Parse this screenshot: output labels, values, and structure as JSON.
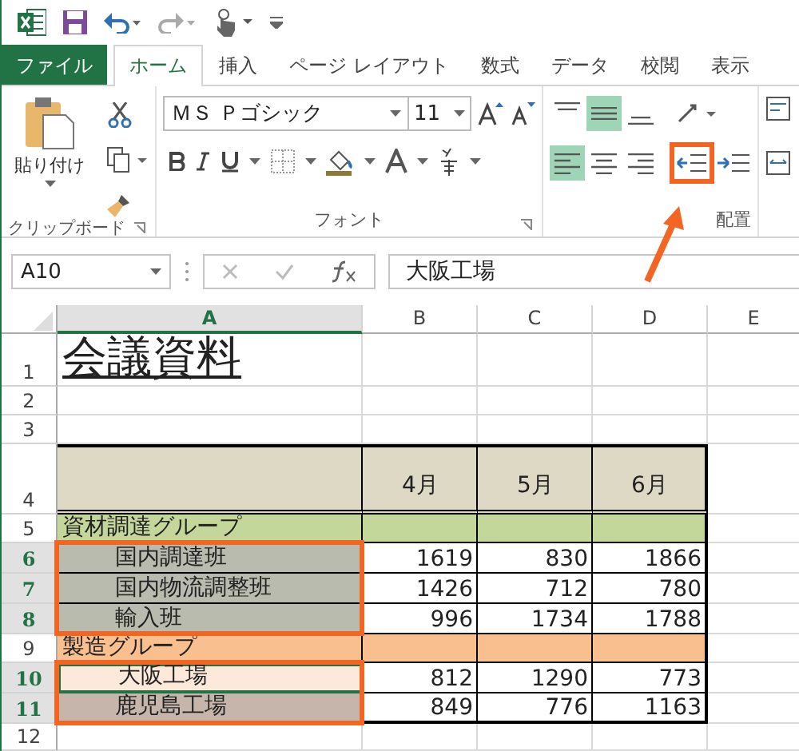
{
  "tabs": [
    {
      "label": "ファイル",
      "kind": "file",
      "selected": false
    },
    {
      "label": "ホーム",
      "kind": "tab",
      "selected": true
    },
    {
      "label": "挿入",
      "kind": "tab",
      "selected": false
    },
    {
      "label": "ページ レイアウト",
      "kind": "tab",
      "selected": false
    },
    {
      "label": "数式",
      "kind": "tab",
      "selected": false
    },
    {
      "label": "データ",
      "kind": "tab",
      "selected": false
    },
    {
      "label": "校閲",
      "kind": "tab",
      "selected": false
    },
    {
      "label": "表示",
      "kind": "tab",
      "selected": false
    }
  ],
  "ribbon": {
    "paste_label": "貼り付け",
    "font_name": "ＭＳ Ｐゴシック",
    "font_size": "11",
    "groups": [
      "クリップボード",
      "フォント",
      "配置"
    ],
    "vertical_align": [
      {
        "kind": "top",
        "selected": false
      },
      {
        "kind": "middle",
        "selected": true
      },
      {
        "kind": "bottom",
        "selected": false
      }
    ],
    "horizontal_align": [
      {
        "kind": "left",
        "selected": true
      },
      {
        "kind": "center",
        "selected": false
      },
      {
        "kind": "right",
        "selected": false
      }
    ],
    "outdent_outlined": true
  },
  "formula_bar": {
    "name_box": "A10",
    "value": "大阪工場"
  },
  "sheet": {
    "columns": [
      {
        "label": "A",
        "selected": true
      },
      {
        "label": "B",
        "selected": false
      },
      {
        "label": "C",
        "selected": false
      },
      {
        "label": "D",
        "selected": false
      },
      {
        "label": "E",
        "selected": false
      }
    ],
    "rows": [
      {
        "number": "1",
        "kind": "title",
        "selected": false,
        "cells": [
          "会議資料"
        ]
      },
      {
        "number": "2",
        "kind": "blank",
        "selected": false,
        "cells": []
      },
      {
        "number": "3",
        "kind": "blank",
        "selected": false,
        "cells": []
      },
      {
        "number": "4",
        "kind": "header",
        "selected": false,
        "color": "#ddd9c4",
        "cells": [
          "",
          "4月",
          "5月",
          "6月"
        ]
      },
      {
        "number": "5",
        "kind": "group",
        "selected": false,
        "color": "#c4d79b",
        "cells": [
          "資材調達グループ"
        ]
      },
      {
        "number": "6",
        "kind": "item",
        "selected": true,
        "outlined": true,
        "active": false,
        "color": "#b8bbad",
        "cells": [
          "国内調達班",
          "1619",
          "830",
          "1866"
        ]
      },
      {
        "number": "7",
        "kind": "item",
        "selected": true,
        "outlined": true,
        "active": false,
        "color": "#b8bbad",
        "cells": [
          "国内物流調整班",
          "1426",
          "712",
          "780"
        ]
      },
      {
        "number": "8",
        "kind": "item",
        "selected": true,
        "outlined": true,
        "active": false,
        "color": "#b8bbad",
        "cells": [
          "輸入班",
          "996",
          "1734",
          "1788"
        ]
      },
      {
        "number": "9",
        "kind": "group",
        "selected": false,
        "color": "#fabf8f",
        "cells": [
          "製造グループ"
        ]
      },
      {
        "number": "10",
        "kind": "item",
        "selected": true,
        "outlined": true,
        "active": true,
        "color": "#fde9d9",
        "cells": [
          "大阪工場",
          "812",
          "1290",
          "773"
        ]
      },
      {
        "number": "11",
        "kind": "item",
        "selected": true,
        "outlined": true,
        "active": false,
        "color": "#c6b5aa",
        "cells": [
          "鹿児島工場",
          "849",
          "776",
          "1163"
        ]
      },
      {
        "number": "12",
        "kind": "blank",
        "selected": false,
        "cells": []
      }
    ]
  }
}
